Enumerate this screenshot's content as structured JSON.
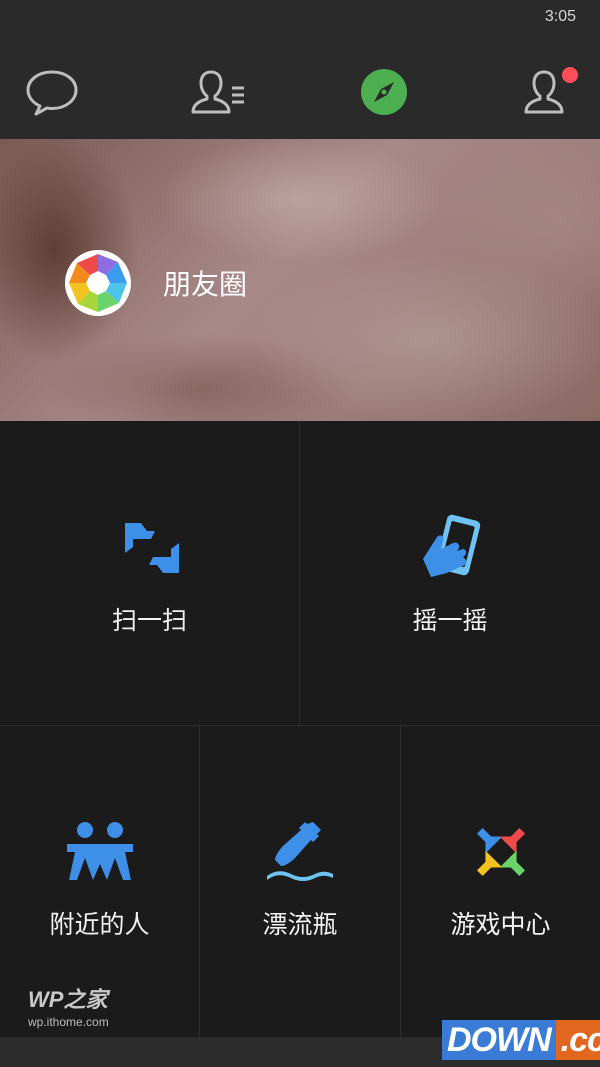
{
  "status_bar": {
    "time": "3:05"
  },
  "nav": {
    "items": [
      {
        "name": "chats",
        "icon": "chat-bubble-icon"
      },
      {
        "name": "contacts",
        "icon": "contacts-list-icon"
      },
      {
        "name": "discover",
        "icon": "compass-icon",
        "active_color": "#4caf50"
      },
      {
        "name": "me",
        "icon": "person-icon",
        "badge_color": "#ff4d5a"
      }
    ]
  },
  "banner": {
    "label": "朋友圈",
    "icon": "moments-aperture-icon"
  },
  "features": [
    {
      "label": "扫一扫",
      "icon": "scan-icon"
    },
    {
      "label": "摇一摇",
      "icon": "shake-phone-icon"
    },
    {
      "label": "附近的人",
      "icon": "people-nearby-icon"
    },
    {
      "label": "漂流瓶",
      "icon": "drift-bottle-icon"
    },
    {
      "label": "游戏中心",
      "icon": "game-center-icon"
    }
  ],
  "watermarks": {
    "wp_title": "WP之家",
    "wp_url": "wp.ithome.com",
    "down_main": "DOWN",
    "down_suffix": ".cc"
  },
  "colors": {
    "accent_blue": "#3d8fe8",
    "discover_green": "#4caf50",
    "badge_red": "#ff4d5a"
  }
}
